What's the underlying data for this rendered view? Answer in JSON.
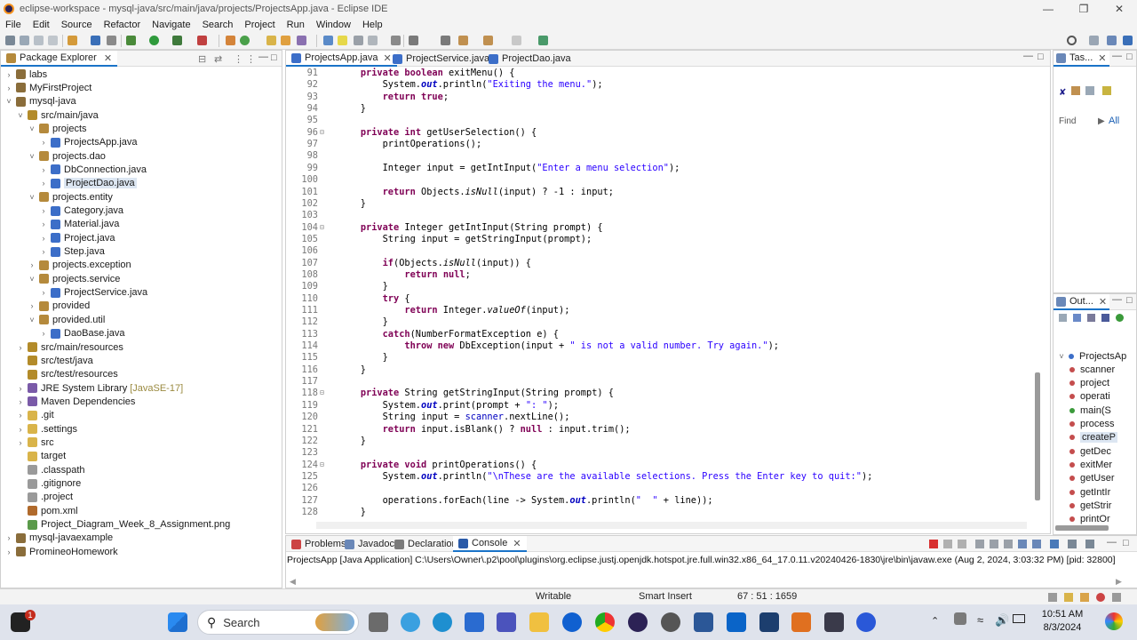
{
  "window": {
    "title": "eclipse-workspace - mysql-java/src/main/java/projects/ProjectsApp.java - Eclipse IDE"
  },
  "menu": [
    "File",
    "Edit",
    "Source",
    "Refactor",
    "Navigate",
    "Search",
    "Project",
    "Run",
    "Window",
    "Help"
  ],
  "package_explorer": {
    "title": "Package Explorer",
    "items": [
      {
        "label": "labs",
        "depth": 0,
        "tw": ">",
        "icon": "project-icon",
        "color": "#8a6d3b"
      },
      {
        "label": "MyFirstProject",
        "depth": 0,
        "tw": ">",
        "icon": "project-icon",
        "color": "#8a6d3b"
      },
      {
        "label": "mysql-java",
        "depth": 0,
        "tw": "v",
        "icon": "project-icon",
        "color": "#8a6d3b"
      },
      {
        "label": "src/main/java",
        "depth": 1,
        "tw": "v",
        "icon": "source-folder-icon",
        "color": "#b38b2a"
      },
      {
        "label": "projects",
        "depth": 2,
        "tw": "v",
        "icon": "package-icon",
        "color": "#b58a3c"
      },
      {
        "label": "ProjectsApp.java",
        "depth": 3,
        "tw": ">",
        "icon": "java-file-icon",
        "color": "#3c6ec8"
      },
      {
        "label": "projects.dao",
        "depth": 2,
        "tw": "v",
        "icon": "package-icon",
        "color": "#b58a3c"
      },
      {
        "label": "DbConnection.java",
        "depth": 3,
        "tw": ">",
        "icon": "java-file-icon",
        "color": "#3c6ec8"
      },
      {
        "label": "ProjectDao.java",
        "depth": 3,
        "tw": ">",
        "icon": "java-file-icon",
        "color": "#3c6ec8",
        "selected": true
      },
      {
        "label": "projects.entity",
        "depth": 2,
        "tw": "v",
        "icon": "package-icon",
        "color": "#b58a3c"
      },
      {
        "label": "Category.java",
        "depth": 3,
        "tw": ">",
        "icon": "java-file-icon",
        "color": "#3c6ec8"
      },
      {
        "label": "Material.java",
        "depth": 3,
        "tw": ">",
        "icon": "java-file-icon",
        "color": "#3c6ec8"
      },
      {
        "label": "Project.java",
        "depth": 3,
        "tw": ">",
        "icon": "java-file-icon",
        "color": "#3c6ec8"
      },
      {
        "label": "Step.java",
        "depth": 3,
        "tw": ">",
        "icon": "java-file-icon",
        "color": "#3c6ec8"
      },
      {
        "label": "projects.exception",
        "depth": 2,
        "tw": ">",
        "icon": "package-icon",
        "color": "#b58a3c"
      },
      {
        "label": "projects.service",
        "depth": 2,
        "tw": "v",
        "icon": "package-icon",
        "color": "#b58a3c"
      },
      {
        "label": "ProjectService.java",
        "depth": 3,
        "tw": ">",
        "icon": "java-file-icon",
        "color": "#3c6ec8"
      },
      {
        "label": "provided",
        "depth": 2,
        "tw": ">",
        "icon": "package-icon",
        "color": "#b58a3c"
      },
      {
        "label": "provided.util",
        "depth": 2,
        "tw": "v",
        "icon": "package-icon",
        "color": "#b58a3c"
      },
      {
        "label": "DaoBase.java",
        "depth": 3,
        "tw": ">",
        "icon": "java-file-icon",
        "color": "#3c6ec8"
      },
      {
        "label": "src/main/resources",
        "depth": 1,
        "tw": ">",
        "icon": "source-folder-icon",
        "color": "#b38b2a"
      },
      {
        "label": "src/test/java",
        "depth": 1,
        "tw": "",
        "icon": "source-folder-icon",
        "color": "#b38b2a"
      },
      {
        "label": "src/test/resources",
        "depth": 1,
        "tw": "",
        "icon": "source-folder-icon",
        "color": "#b38b2a"
      },
      {
        "label": "JRE System Library",
        "suffix": "[JavaSE-17]",
        "depth": 1,
        "tw": ">",
        "icon": "library-icon",
        "color": "#7a5aa8"
      },
      {
        "label": "Maven Dependencies",
        "depth": 1,
        "tw": ">",
        "icon": "library-icon",
        "color": "#7a5aa8"
      },
      {
        "label": ".git",
        "depth": 1,
        "tw": ">",
        "icon": "folder-icon",
        "color": "#d9b44a"
      },
      {
        "label": ".settings",
        "depth": 1,
        "tw": ">",
        "icon": "folder-icon",
        "color": "#d9b44a"
      },
      {
        "label": "src",
        "depth": 1,
        "tw": ">",
        "icon": "folder-icon",
        "color": "#d9b44a"
      },
      {
        "label": "target",
        "depth": 1,
        "tw": "",
        "icon": "folder-icon",
        "color": "#d9b44a"
      },
      {
        "label": ".classpath",
        "depth": 1,
        "tw": "",
        "icon": "file-icon",
        "color": "#9a9a9a"
      },
      {
        "label": ".gitignore",
        "depth": 1,
        "tw": "",
        "icon": "file-icon",
        "color": "#9a9a9a"
      },
      {
        "label": ".project",
        "depth": 1,
        "tw": "",
        "icon": "file-icon",
        "color": "#9a9a9a"
      },
      {
        "label": "pom.xml",
        "depth": 1,
        "tw": "",
        "icon": "xml-file-icon",
        "color": "#b06a2c"
      },
      {
        "label": "Project_Diagram_Week_8_Assignment.png",
        "depth": 1,
        "tw": "",
        "icon": "image-file-icon",
        "color": "#5a9a4a"
      },
      {
        "label": "mysql-javaexample",
        "depth": 0,
        "tw": ">",
        "icon": "project-icon",
        "color": "#8a6d3b"
      },
      {
        "label": "PromineoHomework",
        "depth": 0,
        "tw": ">",
        "icon": "project-icon",
        "color": "#8a6d3b"
      }
    ]
  },
  "editor": {
    "tabs": [
      "ProjectsApp.java",
      "ProjectService.java",
      "ProjectDao.java"
    ],
    "lines": [
      {
        "n": "91",
        "fold": false,
        "html": "    <span class='kw'>private</span> <span class='kw'>boolean</span> exitMenu() {"
      },
      {
        "n": "92",
        "html": "        System.<span class='sfld'>out</span>.println(<span class='str'>\"Exiting the menu.\"</span>);"
      },
      {
        "n": "93",
        "html": "        <span class='kw'>return</span> <span class='kw'>true</span>;"
      },
      {
        "n": "94",
        "html": "    }"
      },
      {
        "n": "95",
        "html": ""
      },
      {
        "n": "96",
        "fold": true,
        "html": "    <span class='kw'>private</span> <span class='kw'>int</span> getUserSelection() {"
      },
      {
        "n": "97",
        "html": "        printOperations();"
      },
      {
        "n": "98",
        "html": ""
      },
      {
        "n": "99",
        "html": "        Integer input = getIntInput(<span class='str'>\"Enter a menu selection\"</span>);"
      },
      {
        "n": "100",
        "html": ""
      },
      {
        "n": "101",
        "html": "        <span class='kw'>return</span> Objects.<span class='ita'>isNull</span>(input) ? -1 : input;"
      },
      {
        "n": "102",
        "html": "    }"
      },
      {
        "n": "103",
        "html": ""
      },
      {
        "n": "104",
        "fold": true,
        "html": "    <span class='kw'>private</span> Integer getIntInput(String prompt) {"
      },
      {
        "n": "105",
        "html": "        String input = getStringInput(prompt);"
      },
      {
        "n": "106",
        "html": ""
      },
      {
        "n": "107",
        "html": "        <span class='kw'>if</span>(Objects.<span class='ita'>isNull</span>(input)) {"
      },
      {
        "n": "108",
        "html": "            <span class='kw'>return</span> <span class='kw'>null</span>;"
      },
      {
        "n": "109",
        "html": "        }"
      },
      {
        "n": "110",
        "html": "        <span class='kw'>try</span> {"
      },
      {
        "n": "111",
        "html": "            <span class='kw'>return</span> Integer.<span class='ita'>valueOf</span>(input);"
      },
      {
        "n": "112",
        "html": "        }"
      },
      {
        "n": "113",
        "html": "        <span class='kw'>catch</span>(NumberFormatException e) {"
      },
      {
        "n": "114",
        "html": "            <span class='kw'>throw</span> <span class='kw'>new</span> DbException(input + <span class='str'>\" is not a valid number. Try again.\"</span>);"
      },
      {
        "n": "115",
        "html": "        }"
      },
      {
        "n": "116",
        "html": "    }"
      },
      {
        "n": "117",
        "html": ""
      },
      {
        "n": "118",
        "fold": true,
        "html": "    <span class='kw'>private</span> String getStringInput(String prompt) {"
      },
      {
        "n": "119",
        "html": "        System.<span class='sfld'>out</span>.print(prompt + <span class='str'>\": \"</span>);"
      },
      {
        "n": "120",
        "html": "        String input = <span class='fld'>scanner</span>.nextLine();"
      },
      {
        "n": "121",
        "html": "        <span class='kw'>return</span> input.isBlank() ? <span class='kw'>null</span> : input.trim();"
      },
      {
        "n": "122",
        "html": "    }"
      },
      {
        "n": "123",
        "html": ""
      },
      {
        "n": "124",
        "fold": true,
        "html": "    <span class='kw'>private</span> <span class='kw'>void</span> printOperations() {"
      },
      {
        "n": "125",
        "html": "        System.<span class='sfld'>out</span>.println(<span class='str'>\"\\nThese are the available selections. Press the Enter key to quit:\"</span>);"
      },
      {
        "n": "126",
        "html": ""
      },
      {
        "n": "127",
        "html": "        operations.forEach(line -> System.<span class='sfld'>out</span>.println(<span class='str'>\"  \"</span> + line));"
      },
      {
        "n": "128",
        "html": "    }"
      }
    ]
  },
  "tasks": {
    "tab": "Tas...",
    "find_placeholder": "Find",
    "all_label": "All"
  },
  "outline": {
    "tab": "Out...",
    "items": [
      {
        "label": "ProjectsAp",
        "color": "#3c6ec8",
        "tw": "v"
      },
      {
        "label": "scanner",
        "color": "#c44d4d"
      },
      {
        "label": "project",
        "color": "#c44d4d"
      },
      {
        "label": "operati",
        "color": "#c44d4d"
      },
      {
        "label": "main(S",
        "color": "#3a9a3a"
      },
      {
        "label": "process",
        "color": "#c44d4d"
      },
      {
        "label": "createP",
        "color": "#c44d4d",
        "selected": true
      },
      {
        "label": "getDec",
        "color": "#c44d4d"
      },
      {
        "label": "exitMer",
        "color": "#c44d4d"
      },
      {
        "label": "getUser",
        "color": "#c44d4d"
      },
      {
        "label": "getIntIr",
        "color": "#c44d4d"
      },
      {
        "label": "getStrir",
        "color": "#c44d4d"
      },
      {
        "label": "printOr",
        "color": "#c44d4d"
      }
    ]
  },
  "console": {
    "tabs": [
      "Problems",
      "Javadoc",
      "Declaration",
      "Console"
    ],
    "text": "ProjectsApp [Java Application] C:\\Users\\Owner\\.p2\\pool\\plugins\\org.eclipse.justj.openjdk.hotspot.jre.full.win32.x86_64_17.0.11.v20240426-1830\\jre\\bin\\javaw.exe  (Aug 2, 2024, 3:03:32 PM) [pid: 32800]"
  },
  "status": {
    "writable": "Writable",
    "insert": "Smart Insert",
    "position": "67 : 51 : 1659"
  },
  "taskbar": {
    "search": "Search",
    "time": "10:51 AM",
    "date": "8/3/2024",
    "badge": "1"
  }
}
